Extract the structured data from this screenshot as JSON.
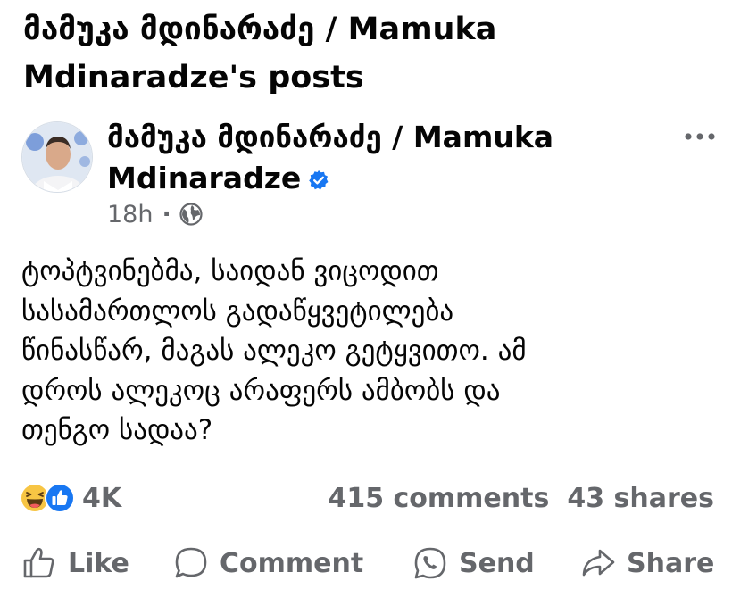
{
  "page": {
    "title": "მამუკა მდინარაძე / Mamuka Mdinaradze's posts"
  },
  "post": {
    "author": "მამუკა მდინარაძე / Mamuka Mdinaradze",
    "verified": true,
    "time": "18h",
    "separator": "·",
    "audience_icon": "globe-icon",
    "text": "ტოპტვინებმა, საიდან ვიცოდით\nსასამართლოს გადაწყვეტილება\nწინასწარ, მაგას ალეკო გეტყვითო. ამ\nდროს ალეკოც არაფერს ამბობს და\nთენგო სადაა?",
    "reactions": {
      "icons": [
        "haha-icon",
        "like-icon"
      ],
      "count": "4K"
    },
    "comments_count": "415 comments",
    "shares_count": "43 shares"
  },
  "actions": {
    "like": "Like",
    "comment": "Comment",
    "send": "Send",
    "share": "Share"
  },
  "colors": {
    "text": "#050505",
    "secondary": "#65676b",
    "verified_blue": "#1877f2",
    "like_blue": "#1877f2",
    "haha_yellow": "#f7c544"
  }
}
